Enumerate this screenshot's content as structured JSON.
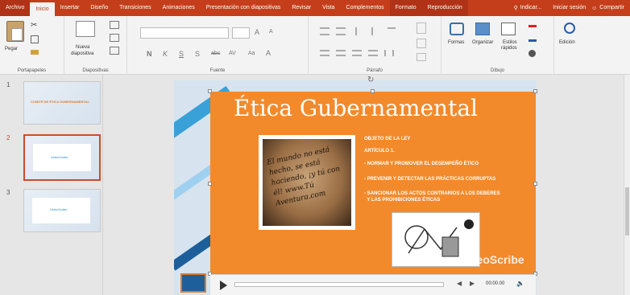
{
  "tabs": [
    {
      "label": "Archivo"
    },
    {
      "label": "Inicio"
    },
    {
      "label": "Insertar"
    },
    {
      "label": "Diseño"
    },
    {
      "label": "Transiciones"
    },
    {
      "label": "Animaciones"
    },
    {
      "label": "Presentación con diapositivas"
    },
    {
      "label": "Revisar"
    },
    {
      "label": "Vista"
    },
    {
      "label": "Complementos"
    },
    {
      "label": "Formato"
    },
    {
      "label": "Reproducción"
    }
  ],
  "tell_me": "Indicar...",
  "sign_in": "Iniciar sesión",
  "share": "Compartir",
  "ribbon": {
    "paste": "Pegar",
    "clipboard": "Portapapeles",
    "new_slide_1": "Nueva",
    "new_slide_2": "diapositiva",
    "slides": "Diapositivas",
    "font": "Fuente",
    "paragraph": "Párrafo",
    "shapes": "Formas",
    "arrange": "Organizar",
    "quick_styles_1": "Estilos",
    "quick_styles_2": "rápidos",
    "drawing": "Dibujo",
    "editing": "Edición",
    "font_size_a_big": "A",
    "font_size_a_small": "A",
    "bold": "N",
    "italic": "K",
    "underline": "S",
    "strike": "S",
    "abc": "abc",
    "spacing": "AV",
    "case": "Aa",
    "color": "A"
  },
  "thumbnails": [
    {
      "num": "1",
      "title": "COMITÉ DE ÉTICA GUBERNAMENTAL"
    },
    {
      "num": "2",
      "title": "VideoScribe"
    },
    {
      "num": "3",
      "title": "VideoScribe"
    }
  ],
  "slide": {
    "title": "Ética Gubernamental",
    "lines": [
      "OBJETO DE LA LEY",
      "ARTÍCULO 1.",
      "- NORMAR Y PROMOVER EL DESEMPEÑO ÉTICO",
      "- PREVENIR Y DETECTAR LAS PRÁCTICAS CORRUPTAS",
      "- SANCIONAR LOS ACTOS CONTRARIOS A LOS DEBERES",
      "  Y LAS PROHIBICIONES ÉTICAS"
    ],
    "photo_text": "El mundo no está hecho, se está haciendo, ¡y tú con él! www.Tú Aventura.com",
    "watermark": "VideoScribe"
  },
  "player": {
    "time": "00:00.00"
  },
  "colors": {
    "accent": "#c43e1c",
    "orange": "#f28a2c"
  }
}
